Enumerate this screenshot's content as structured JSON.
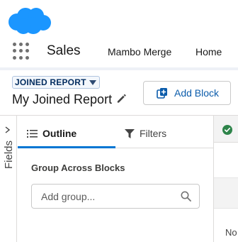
{
  "header": {
    "app_name": "Sales",
    "nav": [
      "Mambo Merge",
      "Home"
    ],
    "brand_color": "#1b96ff"
  },
  "report": {
    "type_badge": "JOINED REPORT",
    "title": "My Joined Report",
    "add_block_label": "Add Block"
  },
  "fields_panel": {
    "label": "Fields"
  },
  "outline_panel": {
    "tabs": [
      {
        "label": "Outline",
        "icon": "list-icon",
        "active": true
      },
      {
        "label": "Filters",
        "icon": "filter-icon",
        "active": false
      }
    ],
    "group_heading": "Group Across Blocks",
    "group_input": {
      "placeholder": "Add group...",
      "value": ""
    }
  },
  "preview": {
    "status_icon": "check-icon",
    "status_color": "#2e844a",
    "truncated_text": "No"
  },
  "colors": {
    "accent": "#0176d3",
    "link": "#0b5cab"
  }
}
